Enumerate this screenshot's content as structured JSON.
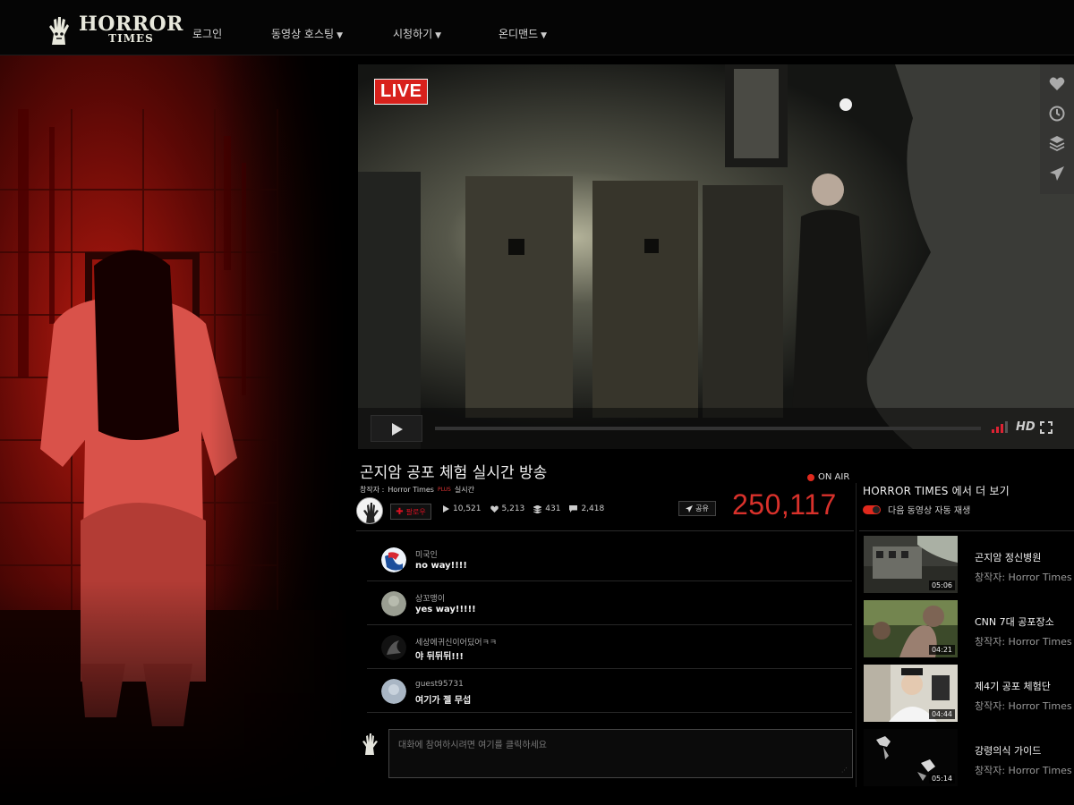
{
  "nav": {
    "logo_line1": "HORROR",
    "logo_line2": "TIMES",
    "items": [
      {
        "label": "로그인"
      },
      {
        "label": "동영상 호스팅"
      },
      {
        "label": "시청하기"
      },
      {
        "label": "온디맨드"
      }
    ]
  },
  "player": {
    "live_label": "LIVE",
    "hd_label": "HD",
    "side_icons": [
      "heart-icon",
      "clock-icon",
      "layers-icon",
      "send-icon"
    ]
  },
  "video": {
    "title": "곤지암 공포 체험 실시간 방송",
    "creator_prefix": "창작자 :",
    "creator_name": "Horror Times",
    "creator_plus": "PLUS",
    "status_tag": "실시간",
    "on_air": "ON AIR",
    "follow_label": "팔로우",
    "share_label": "공유",
    "stats": {
      "plays": "10,521",
      "likes": "5,213",
      "layers": "431",
      "comments": "2,418"
    },
    "viewer_count": "250,117"
  },
  "chat": {
    "messages": [
      {
        "user": "미국인",
        "text": "no way!!!!"
      },
      {
        "user": "상꼬맹이",
        "text": "yes way!!!!!"
      },
      {
        "user": "세상에귀신이어딨어ㅋㅋ",
        "text": "야 뒤뒤뒤!!!"
      },
      {
        "user": "guest95731",
        "text": "여기가 젤 무섭"
      }
    ],
    "input_placeholder": "대화에 참여하시려면 여기를 클릭하세요"
  },
  "sidebar": {
    "title": "HORROR TIMES 에서 더 보기",
    "autoplay_label": "다음 동영상 자동 재생",
    "items": [
      {
        "title": "곤지암 정신병원",
        "author": "창작자: Horror Times",
        "duration": "05:06"
      },
      {
        "title": "CNN 7대 공포장소",
        "author": "창작자: Horror Times",
        "duration": "04:21"
      },
      {
        "title": "제4기 공포 체험단",
        "author": "창작자: Horror Times",
        "duration": "04:44"
      },
      {
        "title": "강령의식 가이드",
        "author": "창작자: Horror Times",
        "duration": "05:14"
      }
    ]
  },
  "colors": {
    "accent_red": "#d8312b",
    "live_red": "#d8211c",
    "background": "#000000"
  }
}
